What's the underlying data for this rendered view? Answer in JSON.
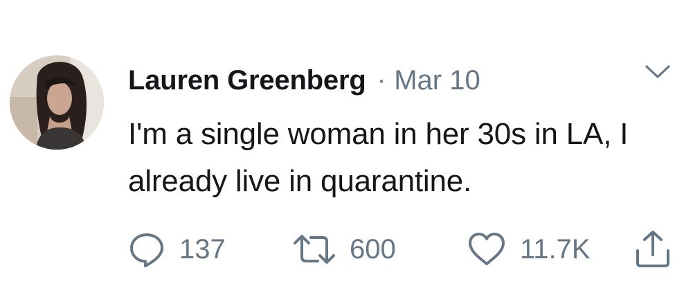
{
  "tweet": {
    "author_name": "Lauren Greenberg",
    "separator": "·",
    "timestamp": "Mar 10",
    "text": "I'm a single woman in her 30s in LA, I already live in quarantine.",
    "actions": {
      "reply": {
        "icon": "reply-icon",
        "count": "137"
      },
      "retweet": {
        "icon": "retweet-icon",
        "count": "600"
      },
      "like": {
        "icon": "heart-icon",
        "count": "11.7K"
      },
      "share": {
        "icon": "share-icon"
      }
    },
    "menu": {
      "icon": "chevron-down-icon"
    }
  },
  "colors": {
    "text_primary": "#14171a",
    "text_secondary": "#657786",
    "background": "#ffffff"
  }
}
